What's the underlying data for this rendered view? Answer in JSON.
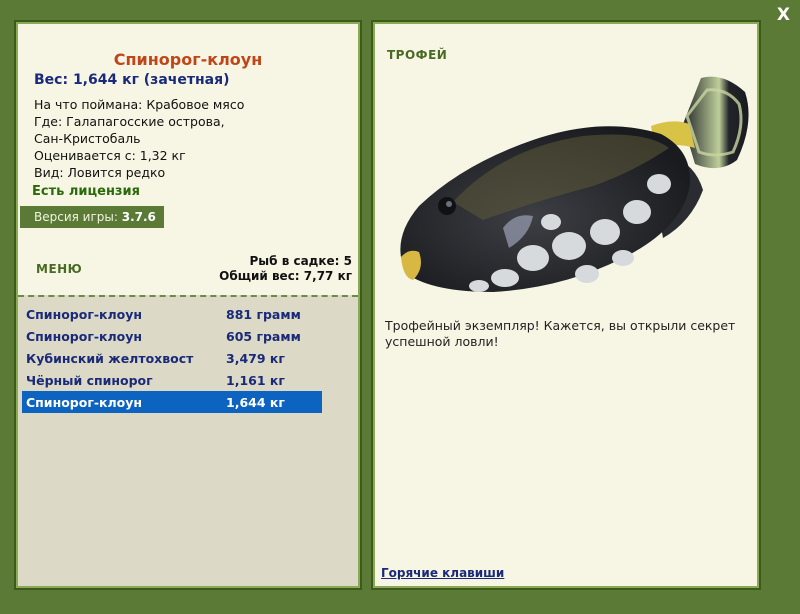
{
  "window": {
    "close_label": "X"
  },
  "fish": {
    "title": "Спинорог-клоун",
    "weight_line": "Вес: 1,644 кг (зачетная)",
    "details": [
      "На что поймана: Крабовое мясо",
      "Где: Галапагосские острова,",
      "Сан-Кристобаль",
      "Оценивается с: 1,32 кг",
      "Вид: Ловится редко"
    ],
    "license": "Есть лицензия"
  },
  "version": {
    "label": "Версия игры:",
    "value": "3.7.6"
  },
  "menu_label": "МЕНЮ",
  "keepnet": {
    "count_line": "Рыб в садке: 5",
    "total_line": "Общий вес: 7,77 кг"
  },
  "catch_list": [
    {
      "name": "Спинорог-клоун",
      "weight": "881 грамм"
    },
    {
      "name": "Спинорог-клоун",
      "weight": "605 грамм"
    },
    {
      "name": "Кубинский желтохвост",
      "weight": "3,479 кг"
    },
    {
      "name": "Чёрный спинорог",
      "weight": "1,161 кг"
    },
    {
      "name": "Спинорог-клоун",
      "weight": "1,644 кг"
    }
  ],
  "selected_index": 4,
  "trophy": {
    "label": "ТРОФЕЙ",
    "text": "Трофейный экземпляр! Кажется, вы открыли секрет успешной ловли!",
    "hotkeys_link": "Горячие клавиши"
  },
  "colors": {
    "frame_green": "#5b7a35",
    "panel_bg": "#f7f6e4",
    "title_orange": "#c0461a",
    "text_navy": "#1a2a7a",
    "selected_row": "#0d63c0",
    "license_green": "#2a6a0a"
  }
}
